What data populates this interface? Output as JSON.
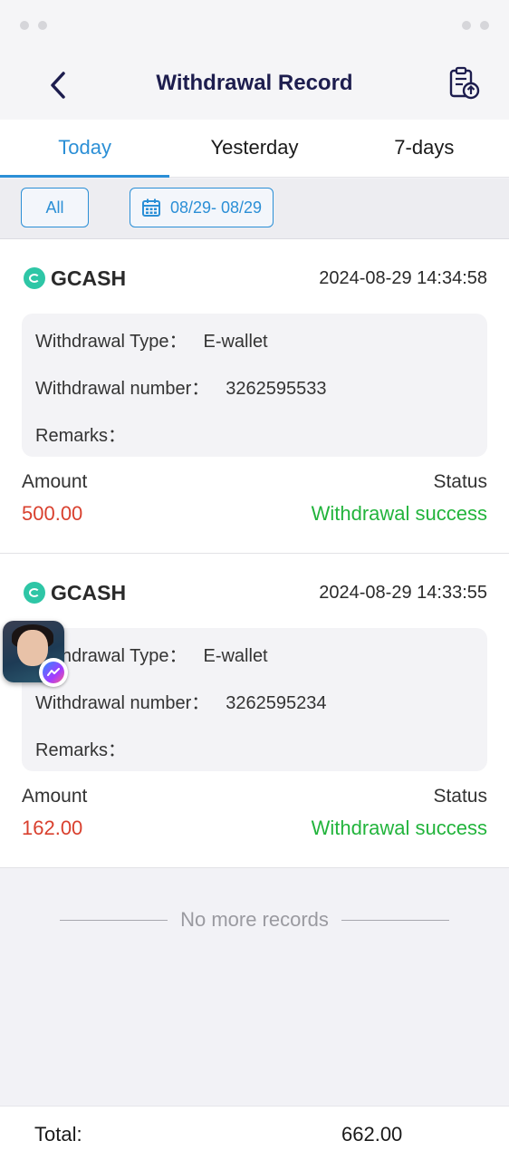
{
  "header": {
    "title": "Withdrawal Record",
    "back_icon": "chevron-left-icon",
    "action_icon": "clipboard-upload-icon"
  },
  "tabs": [
    {
      "label": "Today",
      "active": true
    },
    {
      "label": "Yesterday",
      "active": false
    },
    {
      "label": "7-days",
      "active": false
    }
  ],
  "filters": {
    "type_label": "All",
    "date_range": "08/29- 08/29",
    "date_icon": "calendar-icon"
  },
  "labels": {
    "withdrawal_type": "Withdrawal Type：",
    "withdrawal_number": "Withdrawal number：",
    "remarks": "Remarks：",
    "amount": "Amount",
    "status": "Status"
  },
  "records": [
    {
      "method": "GCASH",
      "time": "2024-08-29 14:34:58",
      "withdrawal_type": "E-wallet",
      "withdrawal_number": "3262595533",
      "remarks": "",
      "amount": "500.00",
      "status": "Withdrawal success"
    },
    {
      "method": "GCASH",
      "time": "2024-08-29 14:33:55",
      "withdrawal_type": "E-wallet",
      "withdrawal_number": "3262595234",
      "remarks": "",
      "amount": "162.00",
      "status": "Withdrawal success"
    }
  ],
  "end_message": "No more records",
  "footer": {
    "total_label": "Total:",
    "total_value": "662.00"
  },
  "colors": {
    "accent": "#2b8fd6",
    "amount": "#d9402e",
    "success": "#22b43c",
    "title": "#1d1d4e"
  }
}
